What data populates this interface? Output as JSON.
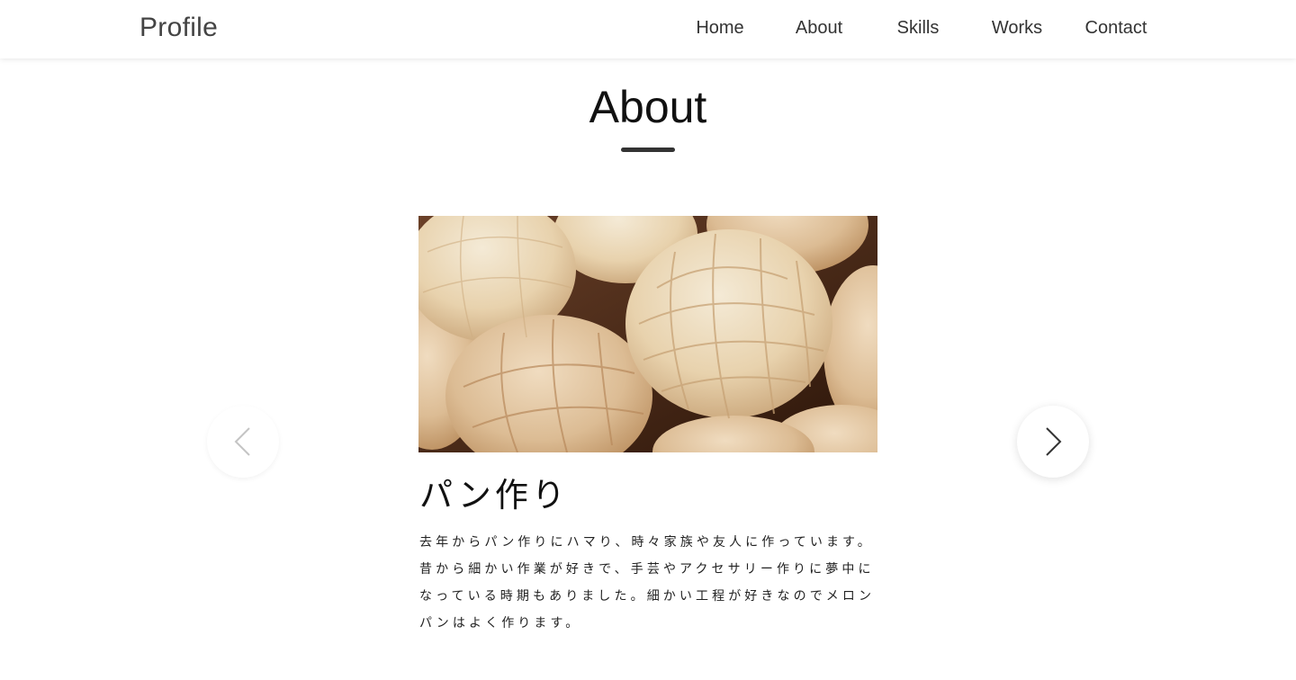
{
  "header": {
    "logo": "Profile",
    "nav": [
      "Home",
      "About",
      "Skills",
      "Works",
      "Contact"
    ]
  },
  "section": {
    "title": "About"
  },
  "slide": {
    "image_icon": "melon-pan-photo",
    "title": "パン作り",
    "text_lines": [
      "去年からパン作りにハマり、時々家族や友人に作っています。",
      "昔から細かい作業が好きで、手芸やアクセサリー作りに夢中に",
      "なっている時期もありました。細かい工程が好きなのでメロン",
      "パンはよく作ります。"
    ]
  },
  "carousel": {
    "prev_icon": "chevron-left-icon",
    "next_icon": "chevron-right-icon"
  },
  "colors": {
    "accent_bar": "#333333",
    "text": "#222222",
    "background": "#ffffff"
  }
}
